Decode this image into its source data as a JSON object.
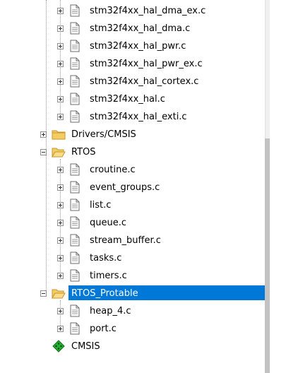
{
  "tree": {
    "nodes": [
      {
        "label": "stm32f4xx_hal_dma_ex.c",
        "type": "file"
      },
      {
        "label": "stm32f4xx_hal_dma.c",
        "type": "file"
      },
      {
        "label": "stm32f4xx_hal_pwr.c",
        "type": "file"
      },
      {
        "label": "stm32f4xx_hal_pwr_ex.c",
        "type": "file"
      },
      {
        "label": "stm32f4xx_hal_cortex.c",
        "type": "file"
      },
      {
        "label": "stm32f4xx_hal.c",
        "type": "file"
      },
      {
        "label": "stm32f4xx_hal_exti.c",
        "type": "file"
      },
      {
        "label": "Drivers/CMSIS",
        "type": "folder-collapsed"
      },
      {
        "label": "RTOS",
        "type": "folder-expanded"
      },
      {
        "label": "croutine.c",
        "type": "file"
      },
      {
        "label": "event_groups.c",
        "type": "file"
      },
      {
        "label": "list.c",
        "type": "file"
      },
      {
        "label": "queue.c",
        "type": "file"
      },
      {
        "label": "stream_buffer.c",
        "type": "file"
      },
      {
        "label": "tasks.c",
        "type": "file"
      },
      {
        "label": "timers.c",
        "type": "file"
      },
      {
        "label": "RTOS_Protable",
        "type": "folder-expanded",
        "selected": true
      },
      {
        "label": "heap_4.c",
        "type": "file"
      },
      {
        "label": "port.c",
        "type": "file"
      },
      {
        "label": "CMSIS",
        "type": "component"
      }
    ]
  },
  "colors": {
    "selection": "#0078d7",
    "folder": "#e8b84a",
    "component": "#1fa12a"
  }
}
